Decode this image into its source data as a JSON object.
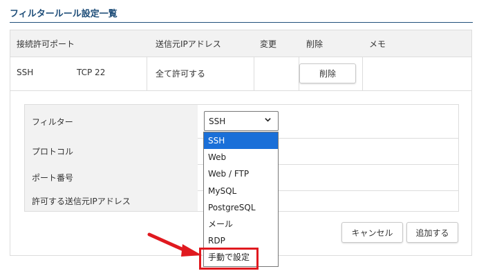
{
  "page": {
    "title": "フィルタールール設定一覧"
  },
  "table": {
    "headers": [
      "接続許可ポート",
      "送信元IPアドレス",
      "変更",
      "削除",
      "メモ"
    ],
    "row": {
      "service": "SSH",
      "port": "TCP 22",
      "source_ip": "全て許可する",
      "delete_label": "削除"
    }
  },
  "form": {
    "filter_label": "フィルター",
    "protocol_label": "プロトコル",
    "port_label": "ポート番号",
    "source_ip_label": "許可する送信元IPアドレス",
    "select_value": "SSH",
    "options": [
      "SSH",
      "Web",
      "Web / FTP",
      "MySQL",
      "PostgreSQL",
      "メール",
      "RDP",
      "手動で設定"
    ],
    "selected_option": "SSH",
    "highlighted_option": "手動で設定"
  },
  "buttons": {
    "cancel": "キャンセル",
    "add": "追加する"
  },
  "colors": {
    "accent": "#1f4e79",
    "selected_option": "#1a6fd8",
    "annotation": "#e0191f"
  },
  "icons": {
    "select_chevron": "chevron-down-icon",
    "annotation_arrow": "red-arrow-icon"
  }
}
